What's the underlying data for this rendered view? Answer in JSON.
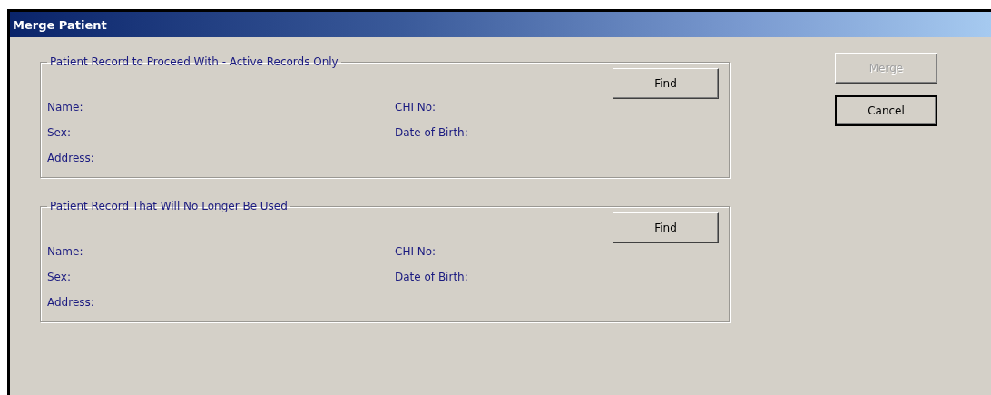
{
  "window": {
    "title": "Merge Patient"
  },
  "groups": [
    {
      "title": "Patient Record to Proceed With - Active Records Only",
      "find_button": "Find",
      "fields": [
        {
          "label": "Name:"
        },
        {
          "label": "CHI No:"
        },
        {
          "label": "Sex:"
        },
        {
          "label": "Date of Birth:"
        },
        {
          "label": "Address:"
        }
      ]
    },
    {
      "title": "Patient Record That Will No Longer Be Used",
      "find_button": "Find",
      "fields": [
        {
          "label": "Name:"
        },
        {
          "label": "CHI No:"
        },
        {
          "label": "Sex:"
        },
        {
          "label": "Date of Birth:"
        },
        {
          "label": "Address:"
        }
      ]
    }
  ],
  "buttons": [
    {
      "label": "Merge",
      "disabled": true,
      "default": false
    },
    {
      "label": "Cancel",
      "disabled": false,
      "default": true
    }
  ]
}
